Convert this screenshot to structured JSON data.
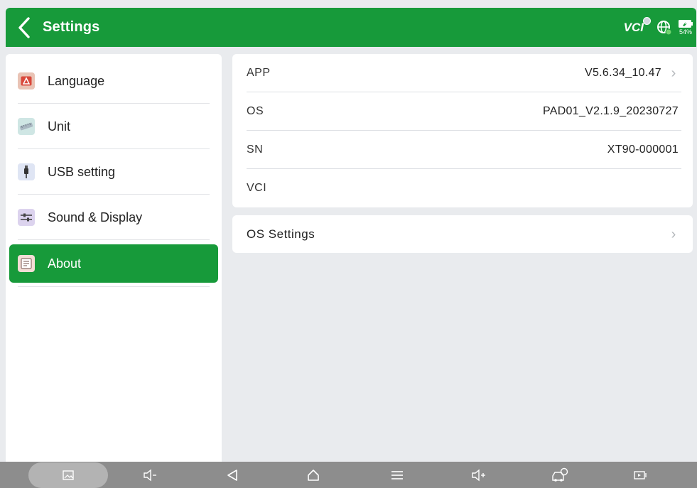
{
  "header": {
    "title": "Settings",
    "vci_label": "VCI",
    "battery_percent": "54%",
    "accent_color": "#179a3a"
  },
  "sidebar": {
    "items": [
      {
        "label": "Language",
        "icon": "language-icon"
      },
      {
        "label": "Unit",
        "icon": "ruler-icon"
      },
      {
        "label": "USB setting",
        "icon": "usb-icon"
      },
      {
        "label": "Sound & Display",
        "icon": "sliders-icon"
      },
      {
        "label": "About",
        "icon": "document-icon",
        "active": true
      }
    ]
  },
  "about": {
    "rows": [
      {
        "label": "APP",
        "value": "V5.6.34_10.47"
      },
      {
        "label": "OS",
        "value": "PAD01_V2.1.9_20230727"
      },
      {
        "label": "SN",
        "value": "XT90-000001"
      },
      {
        "label": "VCI",
        "value": ""
      }
    ],
    "os_settings_label": "OS Settings"
  },
  "navbar": {
    "buttons": [
      "gallery-icon",
      "volume-down-icon",
      "back-triangle-icon",
      "home-icon",
      "menu-icon",
      "volume-up-icon",
      "car-diagnosis-icon",
      "screen-record-icon"
    ]
  }
}
